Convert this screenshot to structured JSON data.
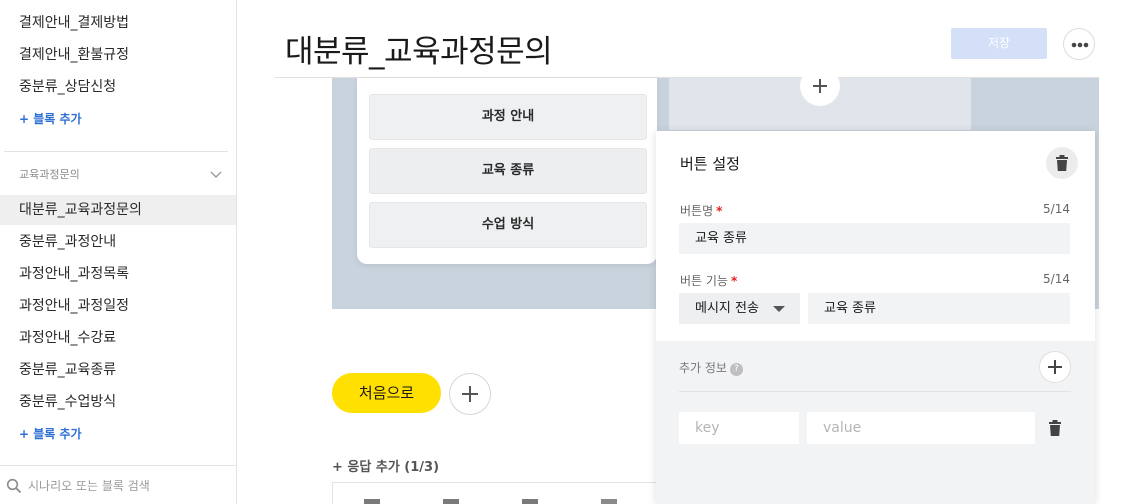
{
  "sidebar": {
    "items_top": [
      "결제안내_결제방법",
      "결제안내_환불규정",
      "중분류_상담신청"
    ],
    "add_block_1": "+ 블록 추가",
    "group_label": "교육과정문의",
    "items_group": [
      "대분류_교육과정문의",
      "중분류_과정안내",
      "과정안내_과정목록",
      "과정안내_과정일정",
      "과정안내_수강료",
      "중분류_교육종류",
      "중분류_수업방식"
    ],
    "add_block_2": "+ 블록 추가",
    "search_placeholder": "시나리오 또는 블록 검색"
  },
  "header": {
    "title": "대분류_교육과정문의",
    "save_label": "저장"
  },
  "card": {
    "buttons": [
      "과정 안내",
      "교육 종류",
      "수업 방식"
    ]
  },
  "bottom": {
    "home_label": "처음으로",
    "response_add": "+ 응답 추가 (1/3)"
  },
  "panel": {
    "title": "버튼 설정",
    "name_label": "버튼명",
    "name_counter": "5/14",
    "name_value": "교육 종류",
    "func_label": "버튼 기능",
    "func_counter": "5/14",
    "func_select": "메시지 전송",
    "func_value": "교육 종류",
    "extra_label": "추가 정보",
    "key_placeholder": "key",
    "value_placeholder": "value"
  },
  "colors": {
    "accent_yellow": "#ffe000",
    "save_disabled": "#d3e0f7",
    "link_blue": "#2f6fd6",
    "required_red": "#e02020",
    "canvas_bg": "#c9d3dd"
  }
}
